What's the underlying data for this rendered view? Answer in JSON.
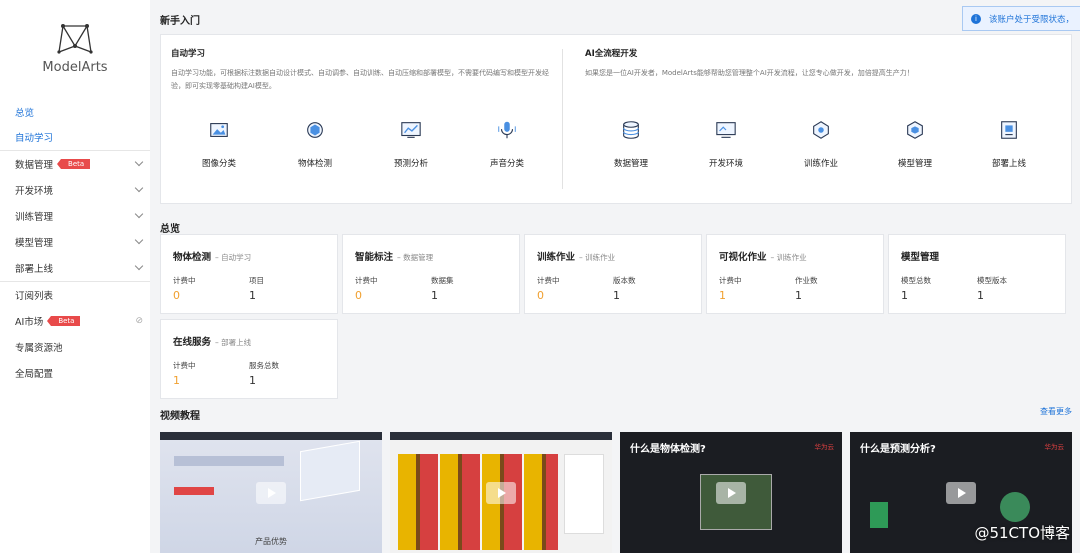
{
  "app": {
    "name": "ModelArts"
  },
  "sidebar": {
    "items": [
      {
        "label": "总览",
        "active": true
      },
      {
        "label": "自动学习",
        "active": true
      },
      {
        "label": "数据管理",
        "badge": "Beta"
      },
      {
        "label": "开发环境"
      },
      {
        "label": "训练管理"
      },
      {
        "label": "模型管理"
      },
      {
        "label": "部署上线"
      },
      {
        "label": "订阅列表"
      },
      {
        "label": "AI市场",
        "badge": "Beta"
      },
      {
        "label": "专属资源池"
      },
      {
        "label": "全局配置"
      }
    ]
  },
  "notice": {
    "text": "该账户处于受限状态，"
  },
  "guide": {
    "title": "新手入门",
    "auto": {
      "title": "自动学习",
      "desc": "自动学习功能，可根据标注数据自动设计模式、自动调参、自动训练、自动压缩和部署模型，不需要代码编写和模型开发经验，即可实现零基础构建AI模型。",
      "items": [
        "图像分类",
        "物体检测",
        "预测分析",
        "声音分类"
      ]
    },
    "full": {
      "title": "AI全流程开发",
      "desc": "如果您是一位AI开发者，ModelArts能够帮助您管理整个AI开发流程，让您专心做开发，加倍提高生产力！",
      "items": [
        "数据管理",
        "开发环境",
        "训练作业",
        "模型管理",
        "部署上线"
      ]
    }
  },
  "overview": {
    "title": "总览",
    "cards": [
      {
        "title": "物体检测",
        "sub": "– 自动学习",
        "m1_label": "计费中",
        "m1_value": "0",
        "m2_label": "项目",
        "m2_value": "1"
      },
      {
        "title": "智能标注",
        "sub": "– 数据管理",
        "m1_label": "计费中",
        "m1_value": "0",
        "m2_label": "数据集",
        "m2_value": "1"
      },
      {
        "title": "训练作业",
        "sub": "– 训练作业",
        "m1_label": "计费中",
        "m1_value": "0",
        "m2_label": "版本数",
        "m2_value": "1"
      },
      {
        "title": "可视化作业",
        "sub": "– 训练作业",
        "m1_label": "计费中",
        "m1_value": "1",
        "m2_label": "作业数",
        "m2_value": "1"
      },
      {
        "title": "模型管理",
        "sub": "",
        "m1_label": "模型总数",
        "m1_value": "1",
        "m2_label": "模型版本",
        "m2_value": "1"
      },
      {
        "title": "在线服务",
        "sub": "– 部署上线",
        "m1_label": "计费中",
        "m1_value": "1",
        "m2_label": "服务总数",
        "m2_value": "1"
      }
    ]
  },
  "videos": {
    "title": "视频教程",
    "more": "查看更多",
    "items": [
      {
        "caption": "产品优势"
      },
      {
        "caption": ""
      },
      {
        "caption": "什么是物体检测?",
        "brand": "华为云"
      },
      {
        "caption": "什么是预测分析?",
        "brand": "华为云"
      }
    ]
  },
  "watermark": "@51CTO博客",
  "colors": {
    "accent": "#1e73d8",
    "orange": "#f0a030",
    "badge": "#e84a4a"
  }
}
